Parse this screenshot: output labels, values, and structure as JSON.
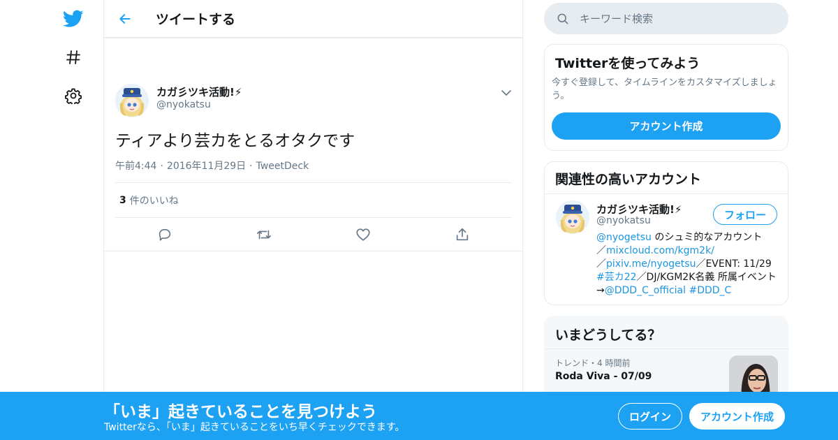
{
  "nav": {
    "icons": [
      "twitter-bird-icon",
      "hashtag-icon",
      "gear-icon"
    ]
  },
  "header": {
    "title": "ツイートする"
  },
  "tweet": {
    "author_name": "カガ彡ツキ活動!⚡",
    "author_handle": "@nyokatsu",
    "text": "ティアより芸カをとるオタクです",
    "time": "午前4:44",
    "date": "2016年11月29日",
    "source": "TweetDeck",
    "likes_count": "3",
    "likes_label": "件のいいね"
  },
  "search": {
    "placeholder": "キーワード検索"
  },
  "signup_card": {
    "title": "Twitterを使ってみよう",
    "description": "今すぐ登録して、タイムラインをカスタマイズしましょう。",
    "button": "アカウント作成"
  },
  "related": {
    "title": "関連性の高いアカウント",
    "name": "カガ彡ツキ活動!⚡",
    "handle": "@nyokatsu",
    "follow_label": "フォロー",
    "bio": {
      "l1": "@nyogetsu",
      "t1": " のシュミ的なアカウント",
      "t2": "／",
      "l2": "mixcloud.com/kgm2k/",
      "t3": "／",
      "l3": "pixiv.me/nyogetsu",
      "t4": "／EVENT: 11/29 ",
      "l4": "#芸カ22",
      "t5": "／DJ/KGM2K名義 所属イベント→",
      "l5": "@DDD_C_official",
      "t6": " ",
      "l6": "#DDD_C"
    }
  },
  "trends": {
    "title": "いまどうしてる？",
    "meta": "トレンド・4 時間前",
    "name": "Roda Viva - 07/09"
  },
  "banner": {
    "title": "「いま」起きていることを見つけよう",
    "subtitle": "Twitterなら、「いま」起きていることをいち早くチェックできます。",
    "login": "ログイン",
    "signup": "アカウント作成"
  },
  "colors": {
    "accent": "#1da1f2",
    "border": "#e6ecf0",
    "secondary_text": "#657786"
  }
}
